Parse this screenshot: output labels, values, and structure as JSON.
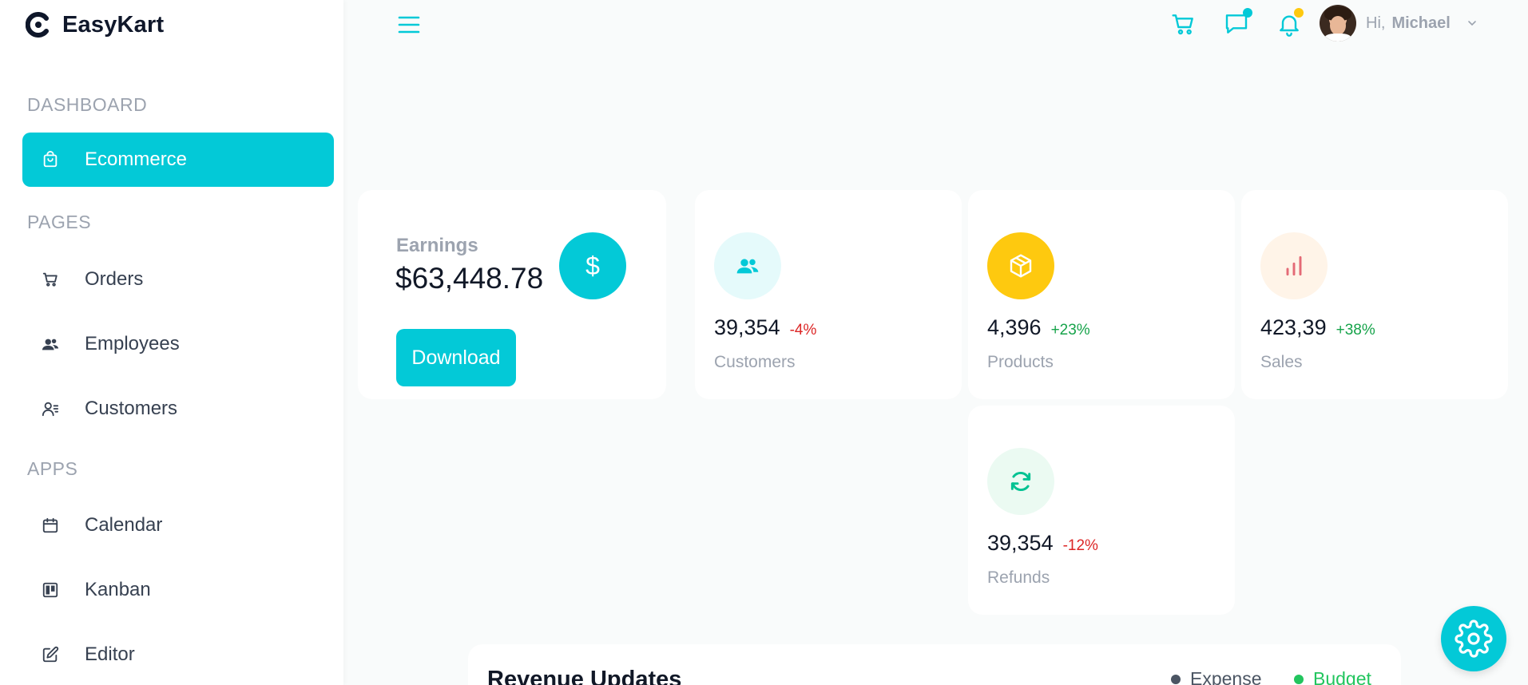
{
  "app": {
    "name": "EasyKart",
    "accent": "#03c9d7"
  },
  "sidebar": {
    "sections": [
      {
        "title": "DASHBOARD"
      },
      {
        "title": "PAGES"
      },
      {
        "title": "APPS"
      }
    ],
    "items": [
      {
        "label": "Ecommerce",
        "icon": "shopping-bag-icon",
        "active": true
      },
      {
        "label": "Orders",
        "icon": "cart-icon"
      },
      {
        "label": "Employees",
        "icon": "users-icon"
      },
      {
        "label": "Customers",
        "icon": "user-list-icon"
      },
      {
        "label": "Calendar",
        "icon": "calendar-icon"
      },
      {
        "label": "Kanban",
        "icon": "kanban-icon"
      },
      {
        "label": "Editor",
        "icon": "edit-icon"
      }
    ]
  },
  "topbar": {
    "greeting": "Hi,",
    "username": "Michael",
    "icons": [
      "menu-icon",
      "cart-icon",
      "chat-icon",
      "bell-icon",
      "chevron-down-icon"
    ]
  },
  "earnings": {
    "label": "Earnings",
    "value": "$63,448.78",
    "currency_symbol": "$",
    "button_label": "Download"
  },
  "stats": [
    {
      "value": "39,354",
      "change": "-4%",
      "trend": "negative",
      "label": "Customers",
      "icon": "users-icon",
      "icon_color": "#03c9d7",
      "icon_bg": "#e5fafb"
    },
    {
      "value": "4,396",
      "change": "+23%",
      "trend": "positive",
      "label": "Products",
      "icon": "box-icon",
      "icon_color": "#ffffff",
      "icon_bg": "#fec90f"
    },
    {
      "value": "423,39",
      "change": "+38%",
      "trend": "positive",
      "label": "Sales",
      "icon": "bar-chart-icon",
      "icon_color": "#e46a76",
      "icon_bg": "#fff4e8"
    },
    {
      "value": "39,354",
      "change": "-12%",
      "trend": "negative",
      "label": "Refunds",
      "icon": "refresh-icon",
      "icon_color": "#00c292",
      "icon_bg": "#ebfaf2"
    }
  ],
  "revenue": {
    "title": "Revenue Updates",
    "legend": [
      {
        "label": "Expense",
        "color": "#4b5563"
      },
      {
        "label": "Budget",
        "color": "#22c55e"
      }
    ]
  }
}
